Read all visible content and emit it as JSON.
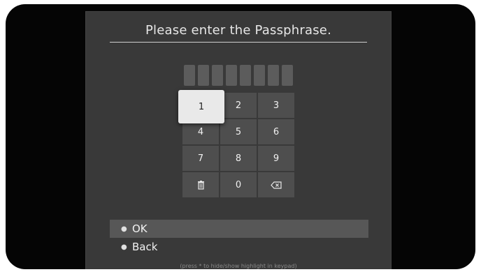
{
  "title": "Please enter the Passphrase.",
  "passphrase": {
    "slots": [
      "",
      "",
      "",
      "",
      "",
      "",
      "",
      ""
    ]
  },
  "keypad": {
    "selected": "1",
    "keys": [
      "1",
      "2",
      "3",
      "4",
      "5",
      "6",
      "7",
      "8",
      "9",
      "trash-icon",
      "0",
      "backspace-icon"
    ]
  },
  "menu": {
    "ok_label": "OK",
    "back_label": "Back",
    "highlighted": "OK"
  },
  "hint": "(press * to hide/show highlight in keypad)",
  "colors": {
    "frame": "#050505",
    "dialog": "#393939",
    "key": "#4e4e4e",
    "key_selected": "#e9e9e9",
    "menu_highlight": "#575757"
  }
}
